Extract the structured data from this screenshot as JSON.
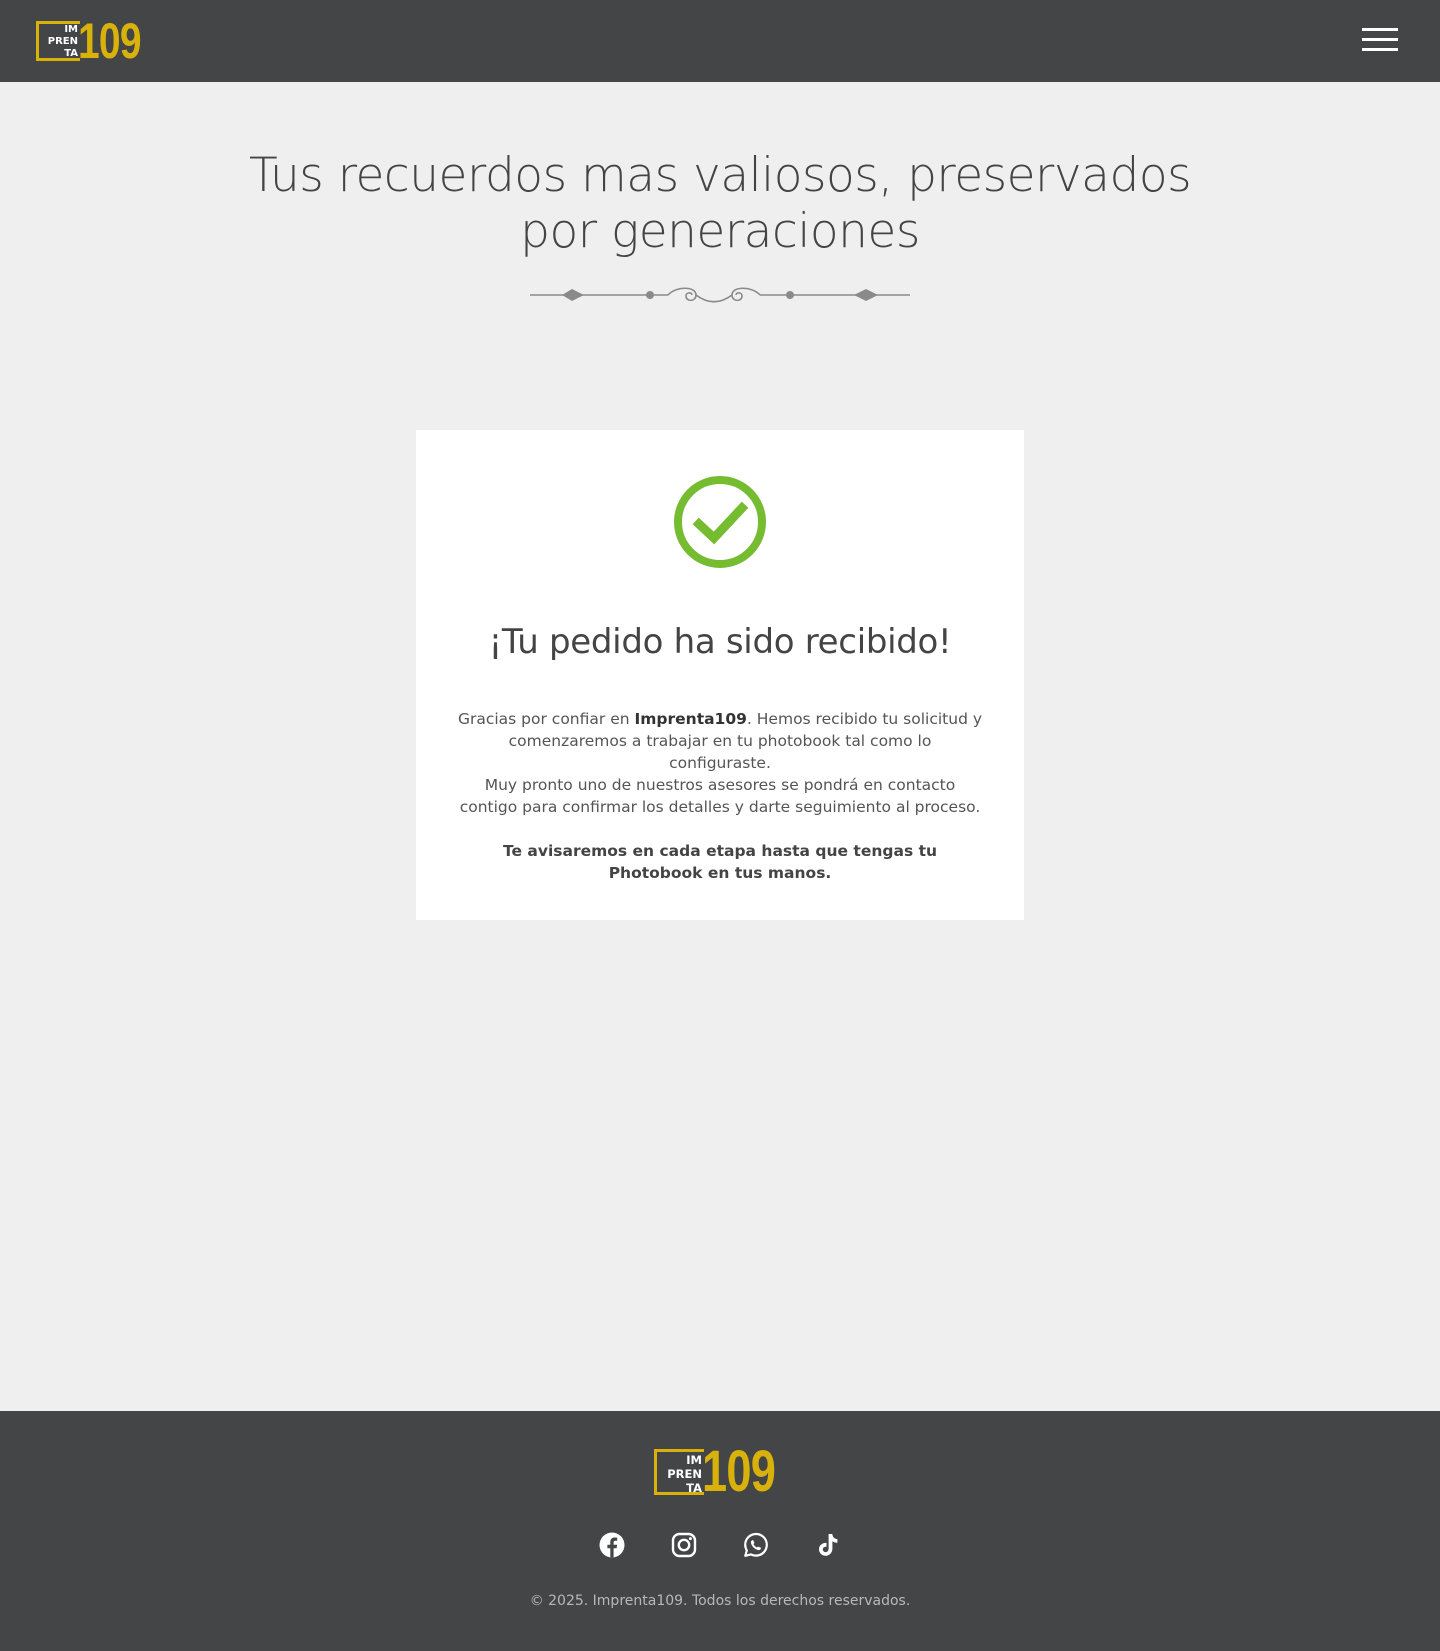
{
  "header": {
    "logo": {
      "box_lines": [
        "IM",
        "PREN",
        "TA"
      ],
      "number": "109"
    },
    "menu_icon": "hamburger-menu-icon"
  },
  "hero": {
    "title_line1": "Tus recuerdos mas valiosos, preservados",
    "title_line2": "por generaciones",
    "ornament_icon": "decorative-divider-icon"
  },
  "confirmation": {
    "status_icon": "check-circle-icon",
    "heading": "¡Tu pedido ha sido recibido!",
    "p1_before": "Gracias por confiar en ",
    "p1_brand": "Imprenta109",
    "p1_after": ". Hemos recibido tu solicitud y comenzaremos a trabajar en tu photobook tal como lo configuraste.",
    "p2": "Muy pronto uno de nuestros asesores se pondrá en contacto contigo para confirmar los detalles y darte seguimiento al proceso.",
    "p3": "Te avisaremos en cada etapa hasta que tengas tu Photobook en tus manos."
  },
  "footer": {
    "logo": {
      "box_lines": [
        "IM",
        "PREN",
        "TA"
      ],
      "number": "109"
    },
    "social": [
      "facebook-icon",
      "instagram-icon",
      "whatsapp-icon",
      "tiktok-icon"
    ],
    "copyright": "© 2025. Imprenta109. Todos los derechos reservados."
  },
  "colors": {
    "header_bg": "#444546",
    "page_bg": "#efefef",
    "brand_yellow": "#d8b20a",
    "success_green": "#76bc30"
  }
}
